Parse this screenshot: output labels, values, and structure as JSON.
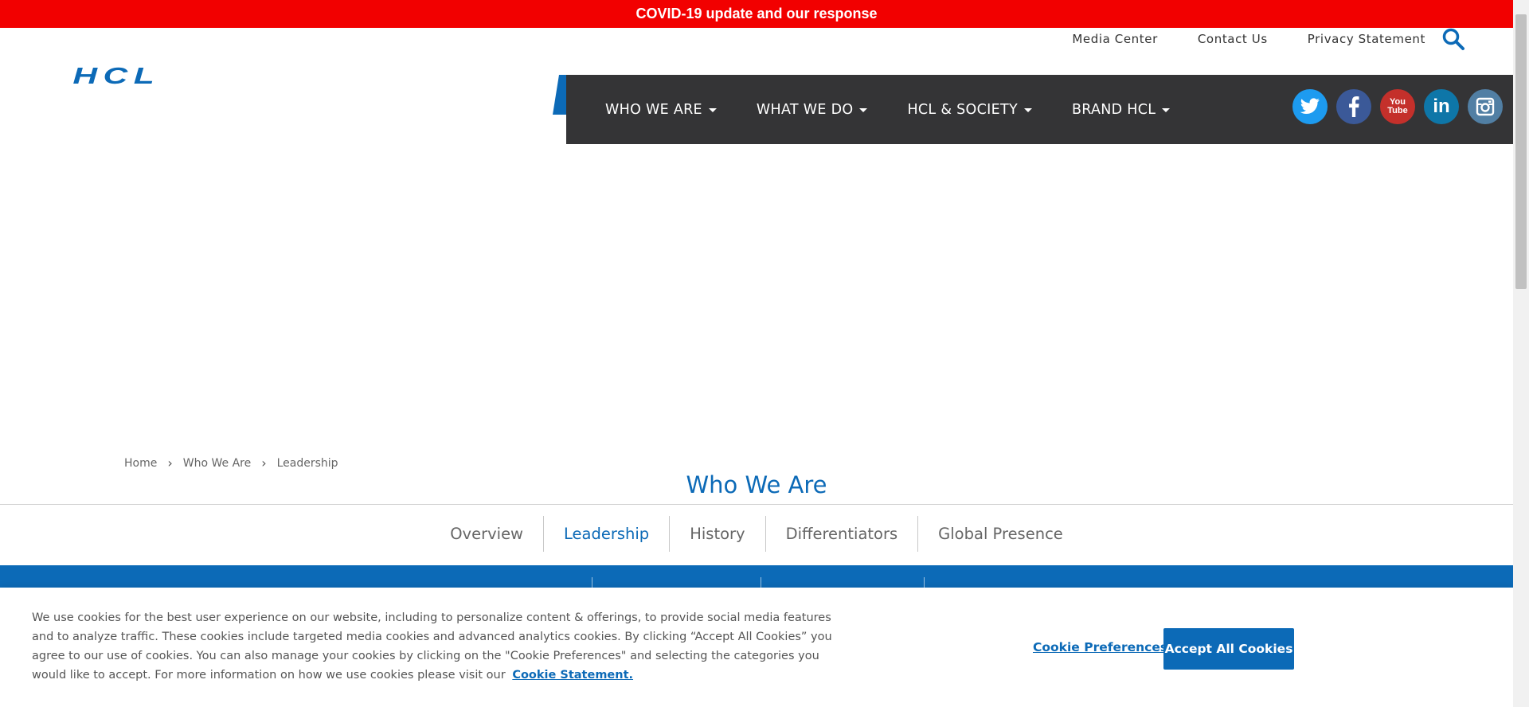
{
  "covid_banner": {
    "text": "COVID-19 update and our response"
  },
  "utility_nav": {
    "items": [
      "Media Center",
      "Contact Us",
      "Privacy Statement"
    ]
  },
  "logo": {
    "text": "HCL",
    "color": "#0c6ab7"
  },
  "main_nav": {
    "items": [
      "WHO WE ARE",
      "WHAT WE DO",
      "HCL & SOCIETY",
      "BRAND HCL"
    ]
  },
  "social": {
    "items": [
      {
        "name": "twitter-icon",
        "color": "#1d9bf0"
      },
      {
        "name": "facebook-icon",
        "color": "#3b5998"
      },
      {
        "name": "youtube-icon",
        "color": "#c4302b"
      },
      {
        "name": "linkedin-icon",
        "color": "#0e76a8"
      },
      {
        "name": "instagram-icon",
        "color": "#517fa4"
      }
    ],
    "youtube_text_1": "You",
    "youtube_text_2": "Tube",
    "linkedin_text": "in"
  },
  "breadcrumb": {
    "items": [
      "Home",
      "Who We Are",
      "Leadership"
    ]
  },
  "section": {
    "title": "Who We Are"
  },
  "tabs": {
    "items": [
      "Overview",
      "Leadership",
      "History",
      "Differentiators",
      "Global Presence"
    ],
    "active": "Leadership"
  },
  "cookie": {
    "message": "We use cookies for the best user experience on our website, including to personalize content & offerings, to provide social media features and to analyze traffic. These cookies include targeted media cookies and advanced analytics cookies. By clicking “Accept All Cookies” you agree to our use of cookies. You can also manage your cookies by clicking on the \"Cookie Preferences\" and selecting the categories you would like to accept. For more information on how we use cookies please visit our",
    "link_label": "Cookie Statement.",
    "preferences_label": "Cookie Preferences",
    "accept_label": "Accept All Cookies"
  },
  "colors": {
    "brand_blue": "#0c6ab7",
    "banner_red": "#f20000",
    "nav_dark": "#343436"
  }
}
